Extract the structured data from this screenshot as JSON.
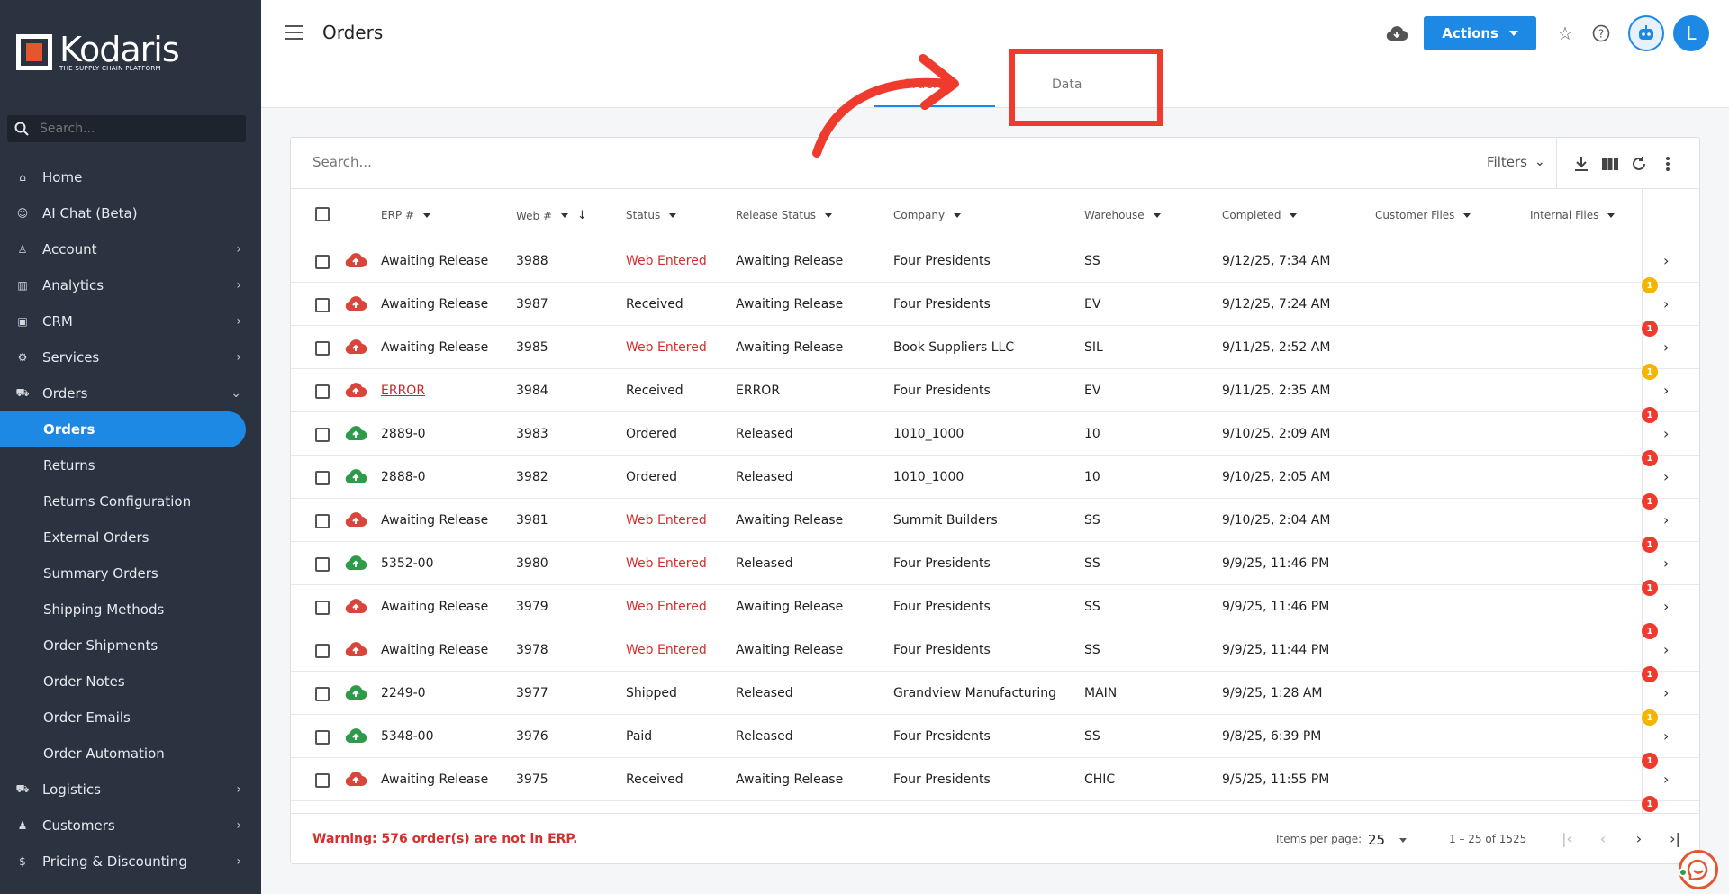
{
  "brand": {
    "name": "Kodaris",
    "tagline": "THE SUPPLY CHAIN PLATFORM"
  },
  "sidebar": {
    "search_placeholder": "Search...",
    "items": [
      {
        "label": "Home",
        "icon": "home-icon",
        "chevron": ""
      },
      {
        "label": "AI Chat (Beta)",
        "icon": "robot-icon",
        "chevron": ""
      },
      {
        "label": "Account",
        "icon": "person-icon",
        "chevron": "›"
      },
      {
        "label": "Analytics",
        "icon": "chart-icon",
        "chevron": "›"
      },
      {
        "label": "CRM",
        "icon": "contact-card-icon",
        "chevron": "›"
      },
      {
        "label": "Services",
        "icon": "services-icon",
        "chevron": "›"
      },
      {
        "label": "Orders",
        "icon": "truck-icon",
        "chevron": "⌄"
      }
    ],
    "orders_sub": [
      "Orders",
      "Returns",
      "Returns Configuration",
      "External Orders",
      "Summary Orders",
      "Shipping Methods",
      "Order Shipments",
      "Order Notes",
      "Order Emails",
      "Order Automation"
    ],
    "bottom_items": [
      {
        "label": "Logistics",
        "icon": "logistics-icon",
        "chevron": "›"
      },
      {
        "label": "Customers",
        "icon": "people-icon",
        "chevron": "›"
      },
      {
        "label": "Pricing & Discounting",
        "icon": "dollar-icon",
        "chevron": "›"
      }
    ]
  },
  "header": {
    "title": "Orders",
    "tabs": [
      "Orders",
      "Data"
    ],
    "actions_label": "Actions",
    "user_initial": "L"
  },
  "table": {
    "search_placeholder": "Search...",
    "filters_label": "Filters",
    "columns": [
      "ERP #",
      "Web #",
      "Status",
      "Release Status",
      "Company",
      "Warehouse",
      "Completed",
      "Customer Files",
      "Internal Files"
    ],
    "rows": [
      {
        "erp": "Awaiting Release",
        "web": "3988",
        "status": "Web Entered",
        "release": "Awaiting Release",
        "company": "Four Presidents",
        "warehouse": "SS",
        "completed": "9/12/25, 7:34 AM",
        "synced": false,
        "badge": ""
      },
      {
        "erp": "Awaiting Release",
        "web": "3987",
        "status": "Received",
        "release": "Awaiting Release",
        "company": "Four Presidents",
        "warehouse": "EV",
        "completed": "9/12/25, 7:24 AM",
        "synced": false,
        "badge": "1",
        "badge_color": "orange"
      },
      {
        "erp": "Awaiting Release",
        "web": "3985",
        "status": "Web Entered",
        "release": "Awaiting Release",
        "company": "Book Suppliers LLC",
        "warehouse": "SIL",
        "completed": "9/11/25, 2:52 AM",
        "synced": false,
        "badge": "1",
        "badge_color": "red"
      },
      {
        "erp": "ERROR",
        "web": "3984",
        "status": "Received",
        "release": "ERROR",
        "company": "Four Presidents",
        "warehouse": "EV",
        "completed": "9/11/25, 2:35 AM",
        "synced": false,
        "badge": "1",
        "badge_color": "orange"
      },
      {
        "erp": "2889-0",
        "web": "3983",
        "status": "Ordered",
        "release": "Released",
        "company": "1010_1000",
        "warehouse": "10",
        "completed": "9/10/25, 2:09 AM",
        "synced": true,
        "badge": "1",
        "badge_color": "red"
      },
      {
        "erp": "2888-0",
        "web": "3982",
        "status": "Ordered",
        "release": "Released",
        "company": "1010_1000",
        "warehouse": "10",
        "completed": "9/10/25, 2:05 AM",
        "synced": true,
        "badge": "1",
        "badge_color": "red"
      },
      {
        "erp": "Awaiting Release",
        "web": "3981",
        "status": "Web Entered",
        "release": "Awaiting Release",
        "company": "Summit Builders",
        "warehouse": "SS",
        "completed": "9/10/25, 2:04 AM",
        "synced": false,
        "badge": "1",
        "badge_color": "red"
      },
      {
        "erp": "5352-00",
        "web": "3980",
        "status": "Web Entered",
        "release": "Released",
        "company": "Four Presidents",
        "warehouse": "SS",
        "completed": "9/9/25, 11:46 PM",
        "synced": true,
        "badge": "1",
        "badge_color": "red"
      },
      {
        "erp": "Awaiting Release",
        "web": "3979",
        "status": "Web Entered",
        "release": "Awaiting Release",
        "company": "Four Presidents",
        "warehouse": "SS",
        "completed": "9/9/25, 11:46 PM",
        "synced": false,
        "badge": "1",
        "badge_color": "red"
      },
      {
        "erp": "Awaiting Release",
        "web": "3978",
        "status": "Web Entered",
        "release": "Awaiting Release",
        "company": "Four Presidents",
        "warehouse": "SS",
        "completed": "9/9/25, 11:44 PM",
        "synced": false,
        "badge": "1",
        "badge_color": "red"
      },
      {
        "erp": "2249-0",
        "web": "3977",
        "status": "Shipped",
        "release": "Released",
        "company": "Grandview Manufacturing",
        "warehouse": "MAIN",
        "completed": "9/9/25, 1:28 AM",
        "synced": true,
        "badge": "1",
        "badge_color": "red"
      },
      {
        "erp": "5348-00",
        "web": "3976",
        "status": "Paid",
        "release": "Released",
        "company": "Four Presidents",
        "warehouse": "SS",
        "completed": "9/8/25, 6:39 PM",
        "synced": true,
        "badge": "1",
        "badge_color": "orange"
      },
      {
        "erp": "Awaiting Release",
        "web": "3975",
        "status": "Received",
        "release": "Awaiting Release",
        "company": "Four Presidents",
        "warehouse": "CHIC",
        "completed": "9/5/25, 11:55 PM",
        "synced": false,
        "badge": "1",
        "badge_color": "red"
      }
    ],
    "trailing_badge": "1"
  },
  "footer": {
    "warning": "Warning: 576 order(s) are not in ERP.",
    "items_per_page_label": "Items per page:",
    "items_per_page": "25",
    "range": "1 – 25 of 1525"
  },
  "colors": {
    "accent": "#1e88e5",
    "sidebar": "#2b3340",
    "error": "#d32f2f",
    "synced": "#2e9b4a",
    "not_synced": "#d9453b",
    "annotation": "#ef3b2d"
  }
}
